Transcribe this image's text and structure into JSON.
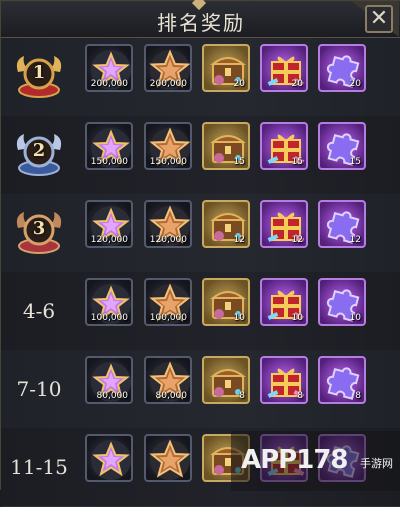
{
  "title": "排名奖励",
  "close_label": "✕",
  "colors": {
    "gold": "#c8a960",
    "purple": "#b25ee6",
    "dark": "#545a6e"
  },
  "items_legend": [
    "star-badge-icon",
    "bronze-star-icon",
    "treasure-chest-icon",
    "gift-box-icon",
    "puzzle-piece-icon"
  ],
  "rows": [
    {
      "rank": "1",
      "rank_type": "medal",
      "medal_color": "gold",
      "quantities": [
        "200,000",
        "200,000",
        "20",
        "20",
        "20"
      ]
    },
    {
      "rank": "2",
      "rank_type": "medal",
      "medal_color": "silver",
      "quantities": [
        "150,000",
        "150,000",
        "15",
        "15",
        "15"
      ]
    },
    {
      "rank": "3",
      "rank_type": "medal",
      "medal_color": "bronze",
      "quantities": [
        "120,000",
        "120,000",
        "12",
        "12",
        "12"
      ]
    },
    {
      "rank": "4-6",
      "rank_type": "text",
      "quantities": [
        "100,000",
        "100,000",
        "10",
        "10",
        "10"
      ]
    },
    {
      "rank": "7-10",
      "rank_type": "text",
      "quantities": [
        "80,000",
        "80,000",
        "8",
        "8",
        "8"
      ]
    },
    {
      "rank": "11-15",
      "rank_type": "text",
      "quantities": [
        "",
        "",
        "",
        "",
        ""
      ]
    }
  ],
  "watermark": {
    "brand": "APP178",
    "sub": "手游网"
  }
}
